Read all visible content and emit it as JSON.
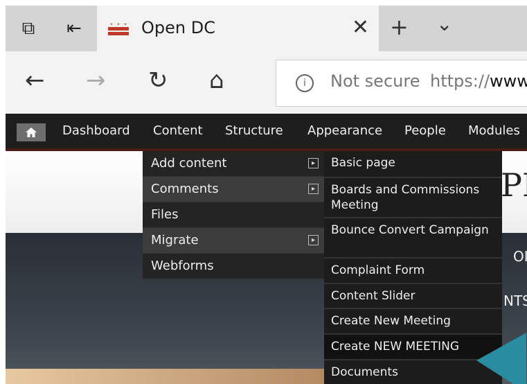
{
  "tab": {
    "title": "Open DC",
    "close_glyph": "✕"
  },
  "tabstrip": {
    "new_tab_glyph": "+",
    "tab_list_glyph": "⌄"
  },
  "nav": {
    "back": "←",
    "forward": "→",
    "refresh": "↻",
    "home": "⌂"
  },
  "address": {
    "security": "Not secure",
    "url_scheme": "https://",
    "url_host": "www"
  },
  "toolbar": {
    "items": [
      "Dashboard",
      "Content",
      "Structure",
      "Appearance",
      "People",
      "Modules"
    ]
  },
  "content_menu": [
    {
      "label": "Add content",
      "has_submenu": true
    },
    {
      "label": "Comments",
      "has_submenu": true,
      "active": true
    },
    {
      "label": "Files",
      "has_submenu": false
    },
    {
      "label": "Migrate",
      "has_submenu": true
    },
    {
      "label": "Webforms",
      "has_submenu": false
    }
  ],
  "add_content_submenu": [
    "Basic page",
    "Boards and Commissions Meeting",
    "Bounce Convert Campaign",
    "Complaint Form",
    "Content Slider",
    "Create New Meeting",
    "Create NEW MEETING",
    "Documents"
  ],
  "background": {
    "heading_fragment": "PE",
    "text_fragment_1": "OI",
    "text_fragment_2": "NTS"
  },
  "colors": {
    "toolbar": "#1e1e1e",
    "toolbar_accent": "#4a1d1a",
    "highlight_arrow": "#2a8ca0",
    "flag_red": "#c0392b"
  }
}
